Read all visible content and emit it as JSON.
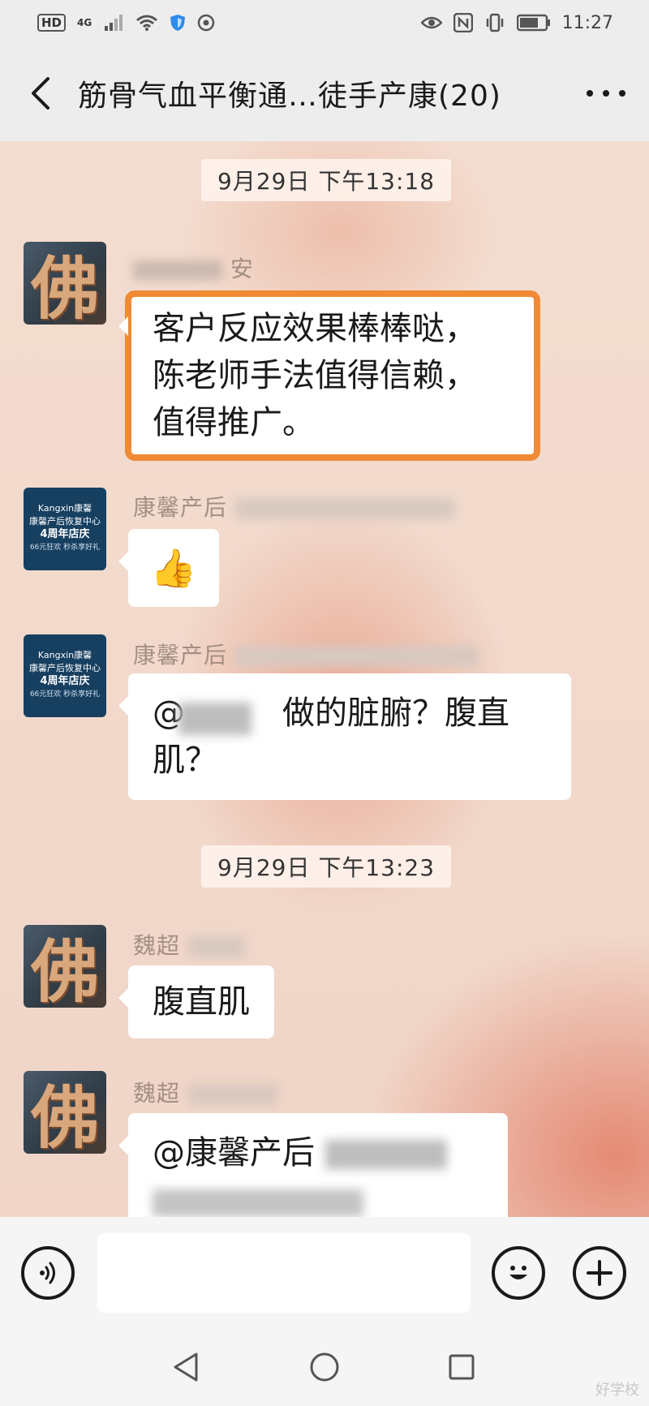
{
  "status_bar": {
    "hd": "HD",
    "network": "4G",
    "time": "11:27",
    "icons": [
      "signal-icon",
      "wifi-icon",
      "shield-icon",
      "location-icon",
      "eye-icon",
      "nfc-icon",
      "vibrate-icon",
      "battery-icon"
    ]
  },
  "header": {
    "title": "筋骨气血平衡通…徒手产康(20)",
    "back_icon": "back-arrow-icon",
    "more_icon": "more-dots-icon"
  },
  "messages": {
    "time1": "9月29日 下午13:18",
    "msg1_sender": "安",
    "msg1_text": [
      "客户反应效果棒棒哒，",
      "陈老师手法值得信赖，",
      "值得推广。"
    ],
    "msg2_sender": "康馨产后",
    "msg2_text": "👍",
    "msg3_sender": "康馨产后",
    "msg3_text": [
      "@　　　做的脏腑？腹直",
      "肌？"
    ],
    "time2": "9月29日 下午13:23",
    "msg4_sender": "魏超",
    "msg4_text": "腹直肌",
    "msg5_sender": "魏超",
    "msg5_text": "@康馨产后",
    "avatar_kx": {
      "line1": "Kangxin康馨",
      "line2": "康馨产后恢复中心",
      "line3": "4周年店庆",
      "line4": "66元狂欢 秒杀享好礼"
    },
    "avatar_fo_glyph": "佛"
  },
  "input_bar": {
    "voice_icon": "voice-icon",
    "emoji_icon": "emoji-icon",
    "plus_icon": "plus-icon"
  },
  "nav_bar": {
    "icons": [
      "nav-back-icon",
      "nav-home-icon",
      "nav-recent-icon"
    ],
    "watermark": "好学校"
  }
}
